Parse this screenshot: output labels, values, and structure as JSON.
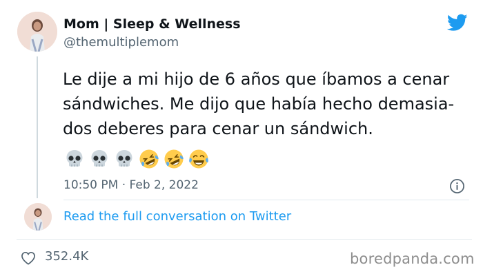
{
  "tweet": {
    "author": {
      "display_name": "Mom | Sleep & Wellness",
      "handle": "@themultiplemom"
    },
    "text_lines": [
      "Le dije a mi hijo de 6 años que íbamos a cenar",
      "sándwiches. Me dijo que había hecho demasia-",
      "dos deberes para cenar un sándwich."
    ],
    "emojis": [
      "skull",
      "skull",
      "skull",
      "rolling-on-floor-laughing",
      "rolling-on-floor-laughing",
      "face-with-tears-of-joy"
    ],
    "timestamp": "10:50 PM · Feb 2, 2022",
    "read_more_label": "Read the full conversation on Twitter",
    "likes": "352.4K"
  },
  "icons": {
    "brand": "twitter-bird-icon",
    "info": "info-icon",
    "like": "heart-icon"
  },
  "colors": {
    "twitter_blue": "#1d9bf0",
    "text_primary": "#0f1419",
    "text_secondary": "#536471"
  },
  "watermark": "boredpanda.com"
}
